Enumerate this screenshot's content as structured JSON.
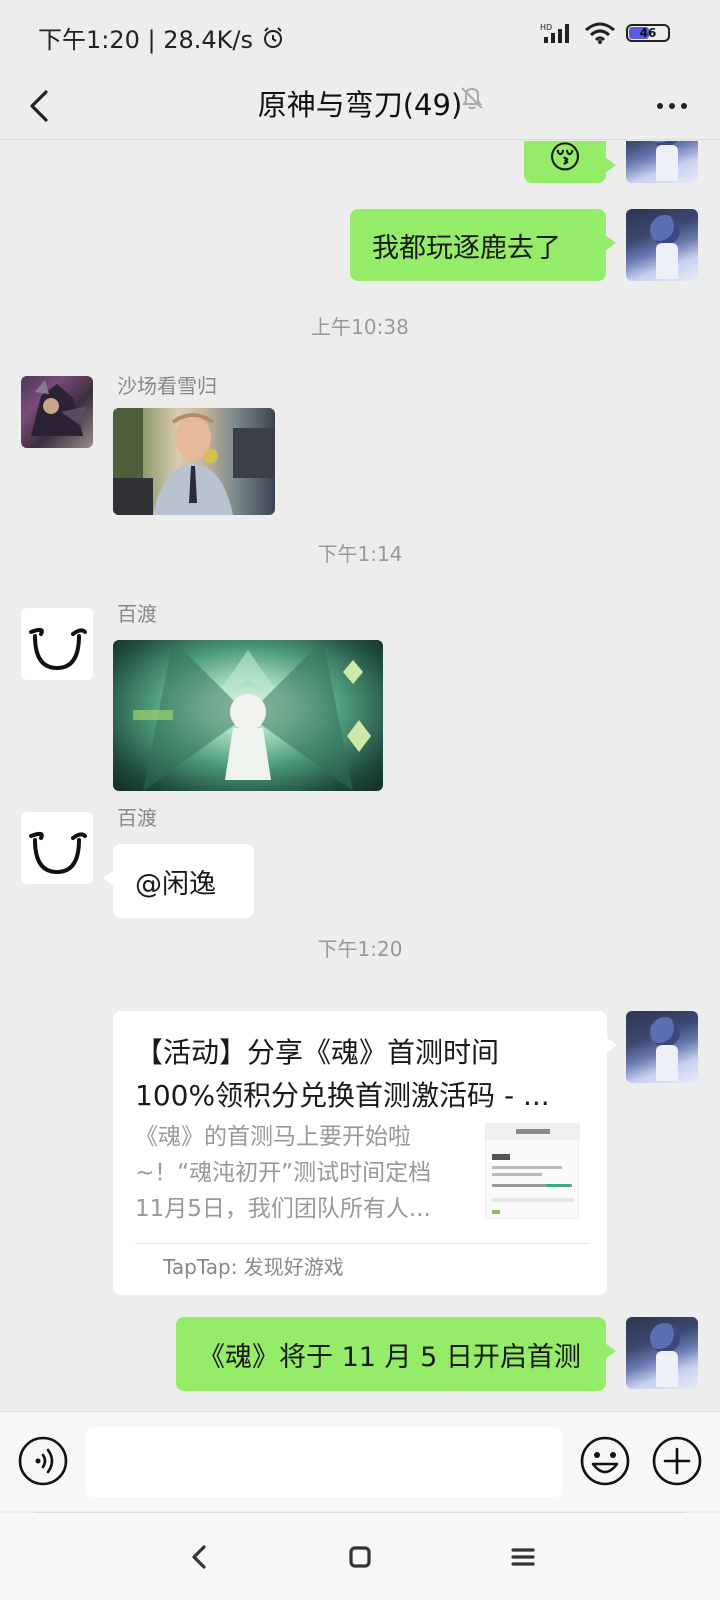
{
  "status_bar": {
    "time_speed": "下午1:20 | 28.4K/s",
    "network": "HD",
    "battery": "46"
  },
  "header": {
    "title": "原神与弯刀(49)"
  },
  "messages": {
    "sent_top_emoji": "😚",
    "sent_1": "我都玩逐鹿去了",
    "time_1": "上午10:38",
    "sender_1": "沙场看雪归",
    "time_2": "下午1:14",
    "sender_2": "百渡",
    "sender_3": "百渡",
    "text_3": "@闲逸",
    "time_3": "下午1:20",
    "card": {
      "title_line1": "【活动】分享《魂》首测时间",
      "title_line2": "100%领积分兑换首测激活码 - ...",
      "desc_line1": "《魂》的首测马上要开始啦",
      "desc_line2": "~！“魂沌初开”测试时间定档",
      "desc_line3": "11月5日，我们团队所有人...",
      "source": "TapTap: 发现好游戏"
    },
    "sent_2": "《魂》将于 11 月 5 日开启首测"
  },
  "input": {
    "value": "",
    "placeholder": ""
  },
  "colors": {
    "bubble_self": "#95ec69",
    "background": "#ededed"
  }
}
